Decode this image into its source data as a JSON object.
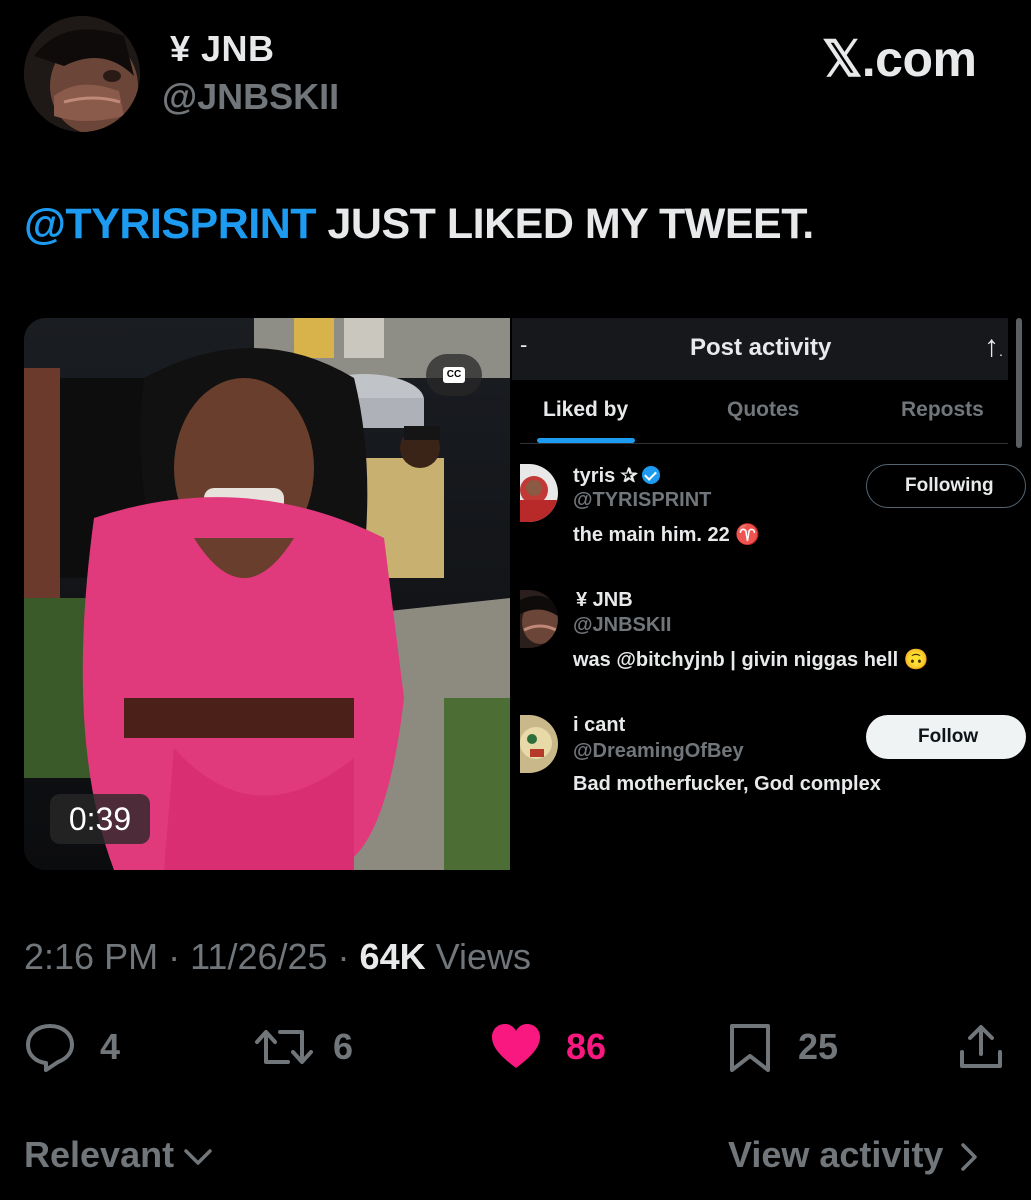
{
  "author": {
    "name": "¥ JNB",
    "handle": "@JNBSKII"
  },
  "watermark": "𝕏.com",
  "tweet": {
    "mention": "@TYRISPRINT",
    "text": " JUST LIKED MY TWEET."
  },
  "video": {
    "cc_label": "CC",
    "duration": "0:39"
  },
  "activity_panel": {
    "title": "Post activity",
    "tabs": [
      {
        "label": "Liked by",
        "active": true
      },
      {
        "label": "Quotes",
        "active": false
      },
      {
        "label": "Reposts",
        "active": false
      }
    ],
    "users": [
      {
        "name": "tyris ✰",
        "verified": true,
        "handle": "@TYRISPRINT",
        "bio": "the main him. 22 ♈",
        "button": "Following"
      },
      {
        "name": "¥ JNB",
        "verified": false,
        "handle": "@JNBSKII",
        "bio": "was @bitchyjnb | givin niggas hell 🙃",
        "button": ""
      },
      {
        "name": "i cant",
        "verified": false,
        "handle": "@DreamingOfBey",
        "bio": "Bad motherfucker, God complex",
        "button": "Follow"
      }
    ]
  },
  "meta": {
    "time": "2:16 PM",
    "sep": " · ",
    "date": "11/26/25",
    "views_count": "64K",
    "views_label": " Views"
  },
  "actions": {
    "replies": "4",
    "reposts": "6",
    "likes": "86",
    "bookmarks": "25",
    "like_color": "#f91880"
  },
  "footer": {
    "relevant": "Relevant",
    "view_activity": "View activity"
  }
}
